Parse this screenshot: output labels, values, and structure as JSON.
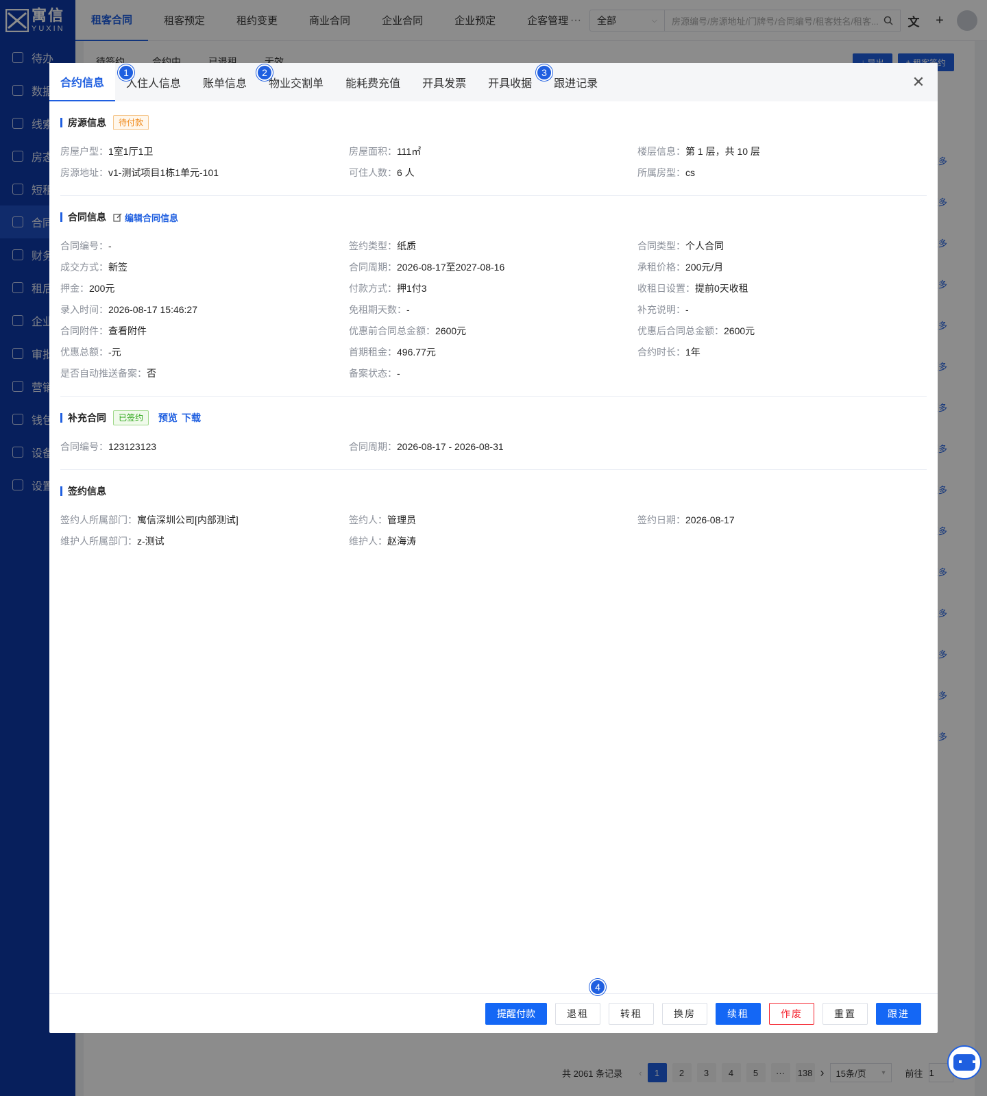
{
  "brand": {
    "cn": "寓信",
    "en": "YUXIN"
  },
  "sidebar": {
    "items": [
      {
        "label": "待办"
      },
      {
        "label": "数据"
      },
      {
        "label": "线索"
      },
      {
        "label": "房态"
      },
      {
        "label": "短租"
      },
      {
        "label": "合同"
      },
      {
        "label": "财务"
      },
      {
        "label": "租后"
      },
      {
        "label": "企业"
      },
      {
        "label": "审批"
      },
      {
        "label": "营销"
      },
      {
        "label": "钱包"
      },
      {
        "label": "设备"
      },
      {
        "label": "设置"
      }
    ]
  },
  "topnav": {
    "items": [
      "租客合同",
      "租客预定",
      "租约变更",
      "商业合同",
      "企业合同",
      "企业预定",
      "企客管理"
    ],
    "more": "···"
  },
  "search": {
    "scope": "全部",
    "placeholder": "房源编号/房源地址/门牌号/合同编号/租客姓名/租客..."
  },
  "bg": {
    "tabs": [
      "待签约",
      "合约中",
      "已退租",
      "无效"
    ],
    "export_label": "导出",
    "sign_label": "租客签约",
    "more_label": "更多",
    "pagination": {
      "total_text": "共 2061 条记录",
      "pages": [
        "1",
        "2",
        "3",
        "4",
        "5",
        "···",
        "138"
      ],
      "size": "15条/页",
      "goto": "前往",
      "goto_value": "1"
    }
  },
  "modal": {
    "tabs": [
      "合约信息",
      "入住人信息",
      "账单信息",
      "物业交割单",
      "能耗费充值",
      "开具发票",
      "开具收据",
      "跟进记录"
    ],
    "badges": [
      "1",
      "2",
      "3",
      "4"
    ],
    "house": {
      "title": "房源信息",
      "status": "待付款",
      "fields": [
        {
          "k": "房屋户型：",
          "v": "1室1厅1卫"
        },
        {
          "k": "房屋面积：",
          "v": "111㎡"
        },
        {
          "k": "楼层信息：",
          "v": "第 1 层，共 10 层"
        },
        {
          "k": "房源地址：",
          "v": "v1-测试项目1栋1单元-101"
        },
        {
          "k": "可住人数：",
          "v": "6 人"
        },
        {
          "k": "所属房型：",
          "v": "cs"
        }
      ]
    },
    "contract": {
      "title": "合同信息",
      "edit_label": "编辑合同信息",
      "fields": [
        {
          "k": "合同编号：",
          "v": "-"
        },
        {
          "k": "签约类型：",
          "v": "纸质"
        },
        {
          "k": "合同类型：",
          "v": "个人合同"
        },
        {
          "k": "成交方式：",
          "v": "新签"
        },
        {
          "k": "合同周期：",
          "v": "2026-08-17至2027-08-16"
        },
        {
          "k": "承租价格：",
          "v": "200元/月"
        },
        {
          "k": "押金：",
          "v": "200元"
        },
        {
          "k": "付款方式：",
          "v": "押1付3"
        },
        {
          "k": "收租日设置：",
          "v": "提前0天收租"
        },
        {
          "k": "录入时间：",
          "v": "2026-08-17 15:46:27"
        },
        {
          "k": "免租期天数：",
          "v": "-"
        },
        {
          "k": "补充说明：",
          "v": "-"
        },
        {
          "k": "合同附件：",
          "v": "查看附件",
          "link": true
        },
        {
          "k": "优惠前合同总金额：",
          "v": "2600元"
        },
        {
          "k": "优惠后合同总金额：",
          "v": "2600元"
        },
        {
          "k": "优惠总额：",
          "v": "-元"
        },
        {
          "k": "首期租金：",
          "v": "496.77元"
        },
        {
          "k": "合约时长：",
          "v": "1年"
        },
        {
          "k": "是否自动推送备案：",
          "v": "否"
        },
        {
          "k": "备案状态：",
          "v": "-"
        }
      ]
    },
    "supplement": {
      "title": "补充合同",
      "status": "已签约",
      "preview": "预览",
      "download": "下载",
      "fields": [
        {
          "k": "合同编号：",
          "v": "123123123"
        },
        {
          "k": "合同周期：",
          "v": "2026-08-17 - 2026-08-31"
        }
      ]
    },
    "signing": {
      "title": "签约信息",
      "fields": [
        {
          "k": "签约人所属部门：",
          "v": "寓信深圳公司[内部测试]"
        },
        {
          "k": "签约人：",
          "v": "管理员"
        },
        {
          "k": "签约日期：",
          "v": "2026-08-17"
        },
        {
          "k": "维护人所属部门：",
          "v": "z-测试"
        },
        {
          "k": "维护人：",
          "v": "赵海涛"
        }
      ]
    },
    "footer": {
      "buttons": [
        {
          "label": "提醒付款",
          "style": "primary wide",
          "name": "remind-payment-button"
        },
        {
          "label": "退租",
          "style": "",
          "name": "checkout-button"
        },
        {
          "label": "转租",
          "style": "",
          "name": "sublet-button"
        },
        {
          "label": "换房",
          "style": "",
          "name": "change-room-button"
        },
        {
          "label": "续租",
          "style": "primary",
          "name": "renew-button"
        },
        {
          "label": "作废",
          "style": "danger",
          "name": "void-button"
        },
        {
          "label": "重置",
          "style": "",
          "name": "reset-button"
        },
        {
          "label": "跟进",
          "style": "primary",
          "name": "follow-up-button"
        }
      ]
    }
  }
}
